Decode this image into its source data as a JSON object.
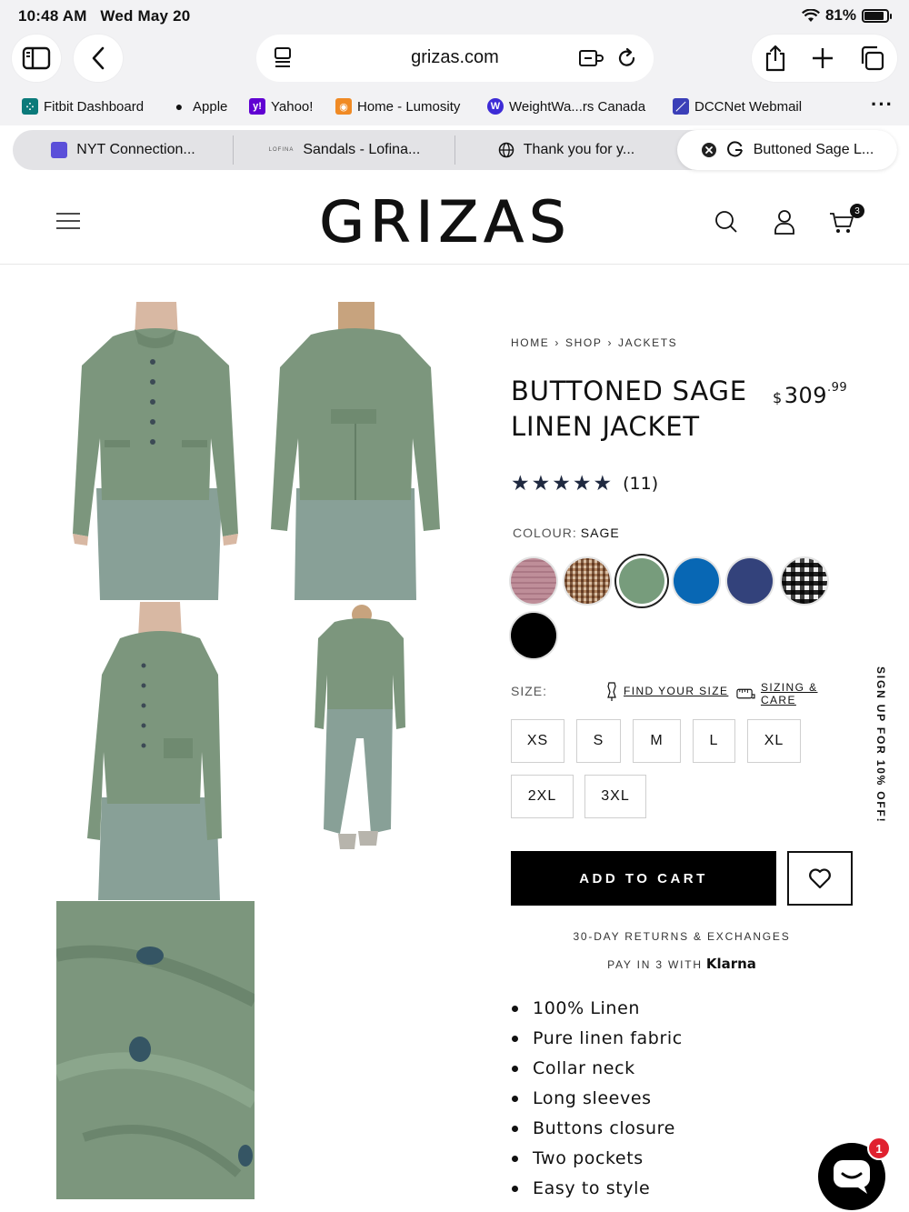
{
  "status_bar": {
    "time": "10:48 AM",
    "date": "Wed May 20",
    "battery": "81%"
  },
  "browser": {
    "url": "grizas.com",
    "bookmarks": [
      {
        "label": "Fitbit Dashboard",
        "icon": "fitbit-icon",
        "color": "#0b7a7a"
      },
      {
        "label": "Apple",
        "icon": "apple-icon",
        "color": "#111111"
      },
      {
        "label": "Yahoo!",
        "icon": "yahoo-icon",
        "color": "#6001d2"
      },
      {
        "label": "Home - Lumosity",
        "icon": "lumosity-icon",
        "color": "#f08a24"
      },
      {
        "label": "WeightWa...rs Canada",
        "icon": "weightwatchers-icon",
        "color": "#3d2bd6"
      },
      {
        "label": "DCCNet Webmail",
        "icon": "webmail-icon",
        "color": "#3b3fb8"
      }
    ],
    "tabs": [
      {
        "label": "NYT Connection...",
        "icon": "nyt-games-icon"
      },
      {
        "label": "Sandals - Lofina...",
        "icon": "lofina-icon"
      },
      {
        "label": "Thank you for y...",
        "icon": "globe-icon"
      },
      {
        "label": "Buttoned Sage L...",
        "icon": "google-icon",
        "active": true
      }
    ]
  },
  "site": {
    "logo": "GRIZAS",
    "cart_count": "3"
  },
  "product": {
    "breadcrumb": [
      "HOME",
      "SHOP",
      "JACKETS"
    ],
    "breadcrumb_sep": "›",
    "title": "BUTTONED SAGE LINEN JACKET",
    "price": {
      "currency": "$",
      "whole": "309",
      "cents": ".99"
    },
    "rating": {
      "stars": 5,
      "count": "(11)"
    },
    "colour_label": "COLOUR:",
    "colour_value": "SAGE",
    "swatches": [
      {
        "name": "pink-plaid",
        "color": "#d9b8c0"
      },
      {
        "name": "brown-plaid",
        "color": "#a98668"
      },
      {
        "name": "sage",
        "color": "#779c7c",
        "selected": true
      },
      {
        "name": "blue",
        "color": "#0867b4"
      },
      {
        "name": "navy",
        "color": "#33427b"
      },
      {
        "name": "black-white-check",
        "color": "#5a5a5a"
      },
      {
        "name": "black",
        "color": "#000000"
      }
    ],
    "size_label": "SIZE:",
    "find_size": "FIND YOUR SIZE",
    "sizing_care": "SIZING & CARE",
    "sizes": [
      "XS",
      "S",
      "M",
      "L",
      "XL",
      "2XL",
      "3XL"
    ],
    "add_to_cart": "ADD TO CART",
    "returns": "30-DAY RETURNS & EXCHANGES",
    "pay_in": "PAY IN 3 WITH",
    "klarna": "Klarna",
    "features": [
      "100% Linen",
      "Pure linen fabric",
      "Collar neck",
      "Long sleeves",
      "Buttons closure",
      "Two pockets",
      "Easy to style"
    ]
  },
  "signup_tab": "SIGN UP FOR 10% OFF!",
  "chat": {
    "unread": "1"
  }
}
